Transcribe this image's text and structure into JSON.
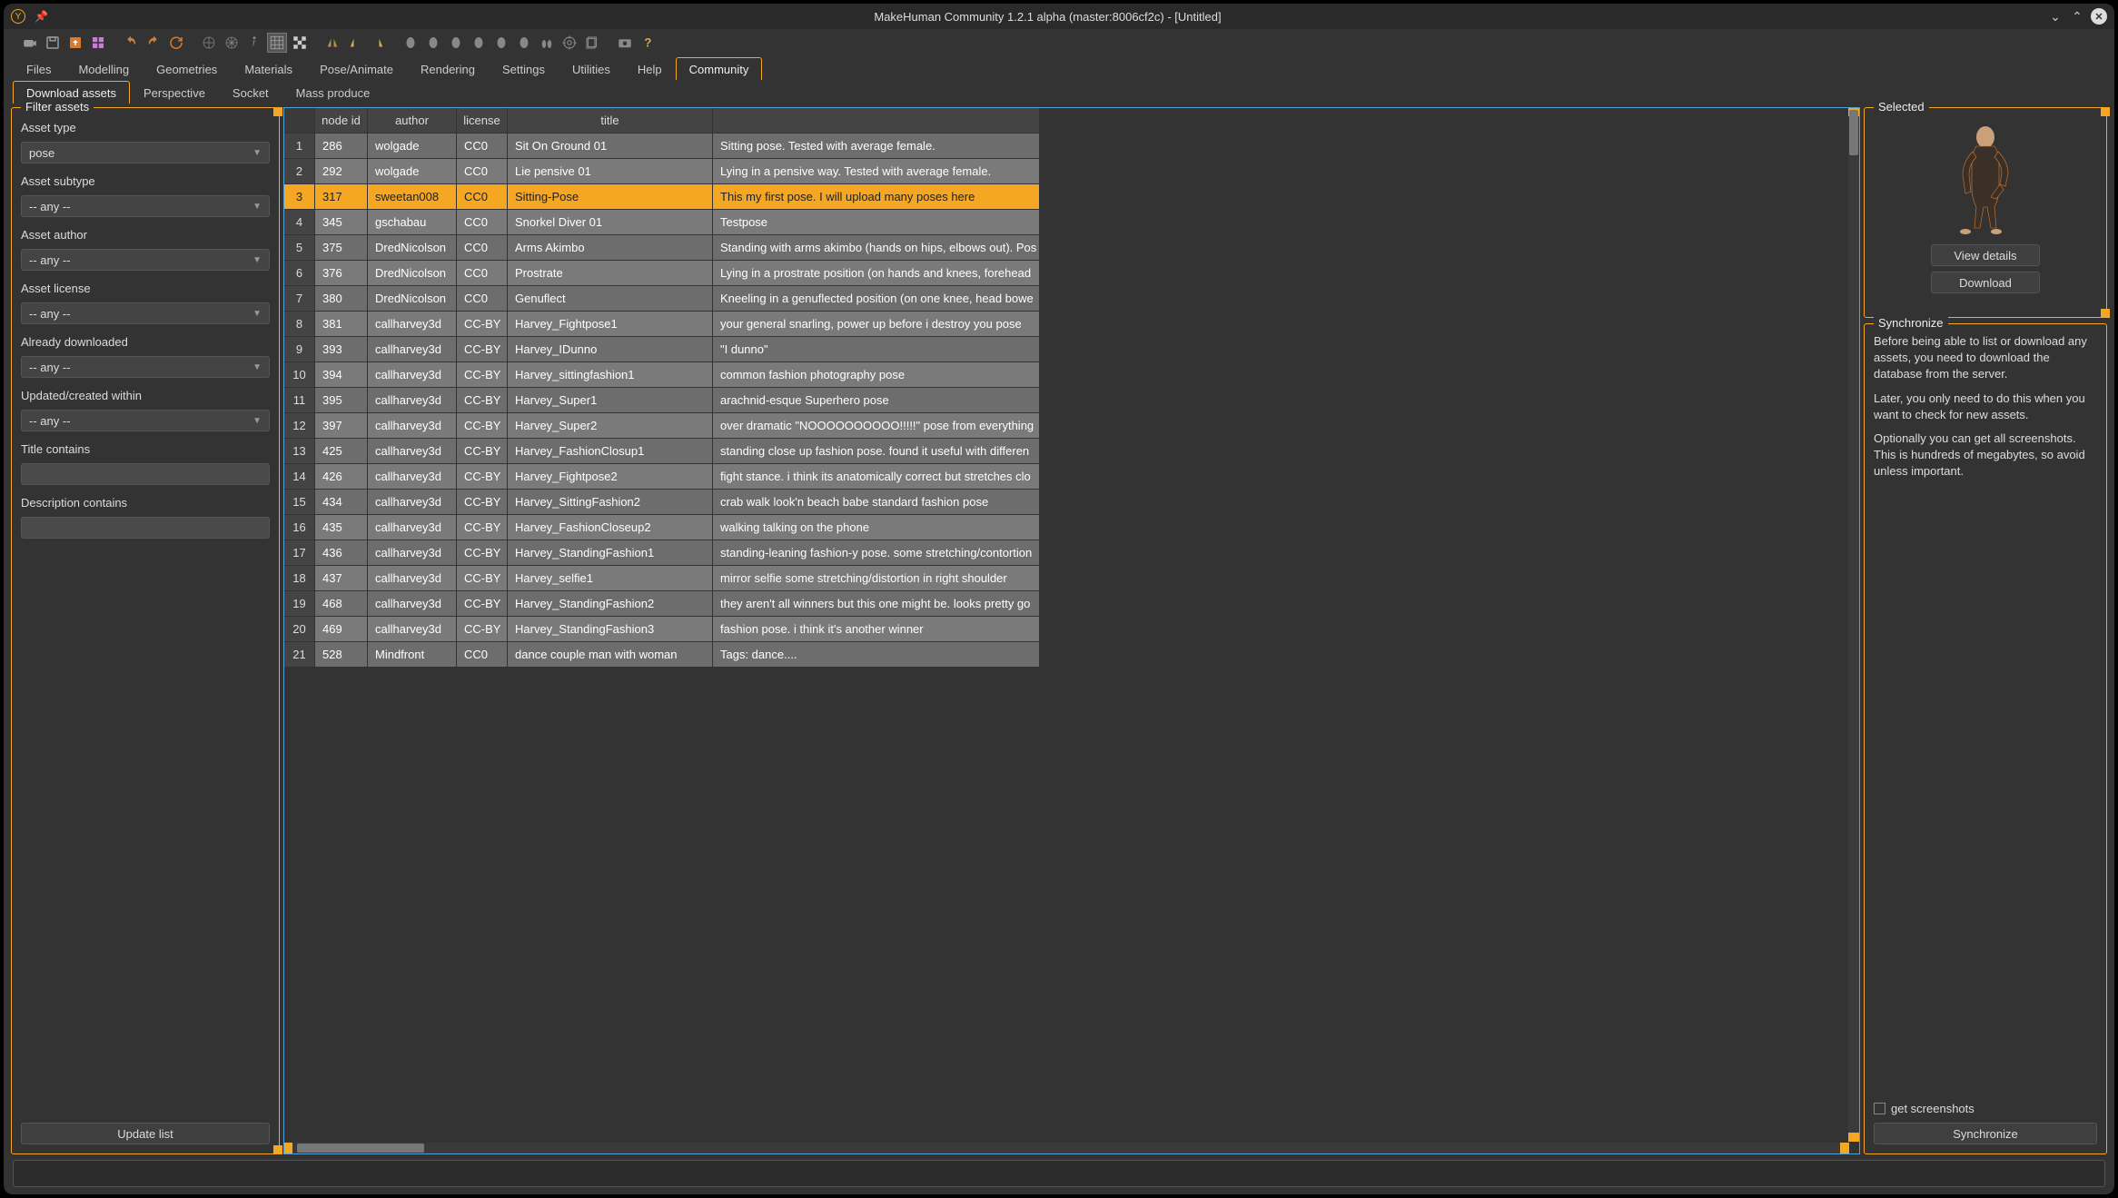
{
  "window": {
    "title": "MakeHuman Community 1.2.1 alpha (master:8006cf2c) - [Untitled]"
  },
  "mainTabs": [
    "Files",
    "Modelling",
    "Geometries",
    "Materials",
    "Pose/Animate",
    "Rendering",
    "Settings",
    "Utilities",
    "Help",
    "Community"
  ],
  "mainTabActive": 9,
  "subTabs": [
    "Download assets",
    "Perspective",
    "Socket",
    "Mass produce"
  ],
  "subTabActive": 0,
  "filter": {
    "panelTitle": "Filter assets",
    "fields": {
      "type_label": "Asset type",
      "type_value": "pose",
      "subtype_label": "Asset subtype",
      "subtype_value": "-- any --",
      "author_label": "Asset author",
      "author_value": "-- any --",
      "license_label": "Asset license",
      "license_value": "-- any --",
      "downloaded_label": "Already downloaded",
      "downloaded_value": "-- any --",
      "updated_label": "Updated/created within",
      "updated_value": "-- any --",
      "title_label": "Title contains",
      "title_value": "",
      "desc_label": "Description contains",
      "desc_value": ""
    },
    "update_button": "Update list"
  },
  "table": {
    "headers": [
      "node id",
      "author",
      "license",
      "title"
    ],
    "selectedRow": 2,
    "rows": [
      {
        "n": "286",
        "author": "wolgade",
        "license": "CC0",
        "title": "Sit On Ground 01",
        "desc": "Sitting pose. Tested with average female."
      },
      {
        "n": "292",
        "author": "wolgade",
        "license": "CC0",
        "title": "Lie pensive 01",
        "desc": "Lying in a pensive way. Tested with average female."
      },
      {
        "n": "317",
        "author": "sweetan008",
        "license": "CC0",
        "title": "Sitting-Pose",
        "desc": "This my first pose. I will upload many poses here"
      },
      {
        "n": "345",
        "author": "gschabau",
        "license": "CC0",
        "title": "Snorkel Diver 01",
        "desc": "Testpose"
      },
      {
        "n": "375",
        "author": "DredNicolson",
        "license": "CC0",
        "title": "Arms Akimbo",
        "desc": "Standing with arms akimbo (hands on hips, elbows out). Pos"
      },
      {
        "n": "376",
        "author": "DredNicolson",
        "license": "CC0",
        "title": "Prostrate",
        "desc": "Lying in a prostrate position (on hands and knees, forehead"
      },
      {
        "n": "380",
        "author": "DredNicolson",
        "license": "CC0",
        "title": "Genuflect",
        "desc": "Kneeling in a genuflected position (on one knee, head bowe"
      },
      {
        "n": "381",
        "author": "callharvey3d",
        "license": "CC-BY",
        "title": "Harvey_Fightpose1",
        "desc": "your general snarling, power up before i destroy you pose"
      },
      {
        "n": "393",
        "author": "callharvey3d",
        "license": "CC-BY",
        "title": "Harvey_IDunno",
        "desc": "\"I dunno\""
      },
      {
        "n": "394",
        "author": "callharvey3d",
        "license": "CC-BY",
        "title": "Harvey_sittingfashion1",
        "desc": "common fashion photography pose"
      },
      {
        "n": "395",
        "author": "callharvey3d",
        "license": "CC-BY",
        "title": "Harvey_Super1",
        "desc": "arachnid-esque Superhero pose"
      },
      {
        "n": "397",
        "author": "callharvey3d",
        "license": "CC-BY",
        "title": "Harvey_Super2",
        "desc": "over dramatic \"NOOOOOOOOOO!!!!!\"  pose from everything"
      },
      {
        "n": "425",
        "author": "callharvey3d",
        "license": "CC-BY",
        "title": "Harvey_FashionClosup1",
        "desc": "standing close up fashion pose.  found it useful with differen"
      },
      {
        "n": "426",
        "author": "callharvey3d",
        "license": "CC-BY",
        "title": "Harvey_Fightpose2",
        "desc": "fight stance.  i think its anatomically correct but stretches clo"
      },
      {
        "n": "434",
        "author": "callharvey3d",
        "license": "CC-BY",
        "title": "Harvey_SittingFashion2",
        "desc": "crab walk look'n beach babe standard fashion pose"
      },
      {
        "n": "435",
        "author": "callharvey3d",
        "license": "CC-BY",
        "title": "Harvey_FashionCloseup2",
        "desc": "walking talking on the phone"
      },
      {
        "n": "436",
        "author": "callharvey3d",
        "license": "CC-BY",
        "title": "Harvey_StandingFashion1",
        "desc": "standing-leaning fashion-y pose.  some stretching/contortion"
      },
      {
        "n": "437",
        "author": "callharvey3d",
        "license": "CC-BY",
        "title": "Harvey_selfie1",
        "desc": "mirror selfie      some stretching/distortion in right shoulder"
      },
      {
        "n": "468",
        "author": "callharvey3d",
        "license": "CC-BY",
        "title": "Harvey_StandingFashion2",
        "desc": "they aren't all winners but this one might be.  looks pretty go"
      },
      {
        "n": "469",
        "author": "callharvey3d",
        "license": "CC-BY",
        "title": "Harvey_StandingFashion3",
        "desc": "fashion pose.  i think it's another winner"
      },
      {
        "n": "528",
        "author": "Mindfront",
        "license": "CC0",
        "title": "dance couple man with woman",
        "desc": "Tags: dance...."
      }
    ]
  },
  "selected": {
    "panelTitle": "Selected",
    "view_button": "View details",
    "download_button": "Download"
  },
  "sync": {
    "panelTitle": "Synchronize",
    "para1": "Before being able to list or download any assets, you need to download the database from the server.",
    "para2": "Later, you only need to do this when you want to check for new assets.",
    "para3": "Optionally you can get all screenshots. This is hundreds of megabytes, so avoid unless important.",
    "checkbox_label": "get screenshots",
    "sync_button": "Synchronize"
  }
}
